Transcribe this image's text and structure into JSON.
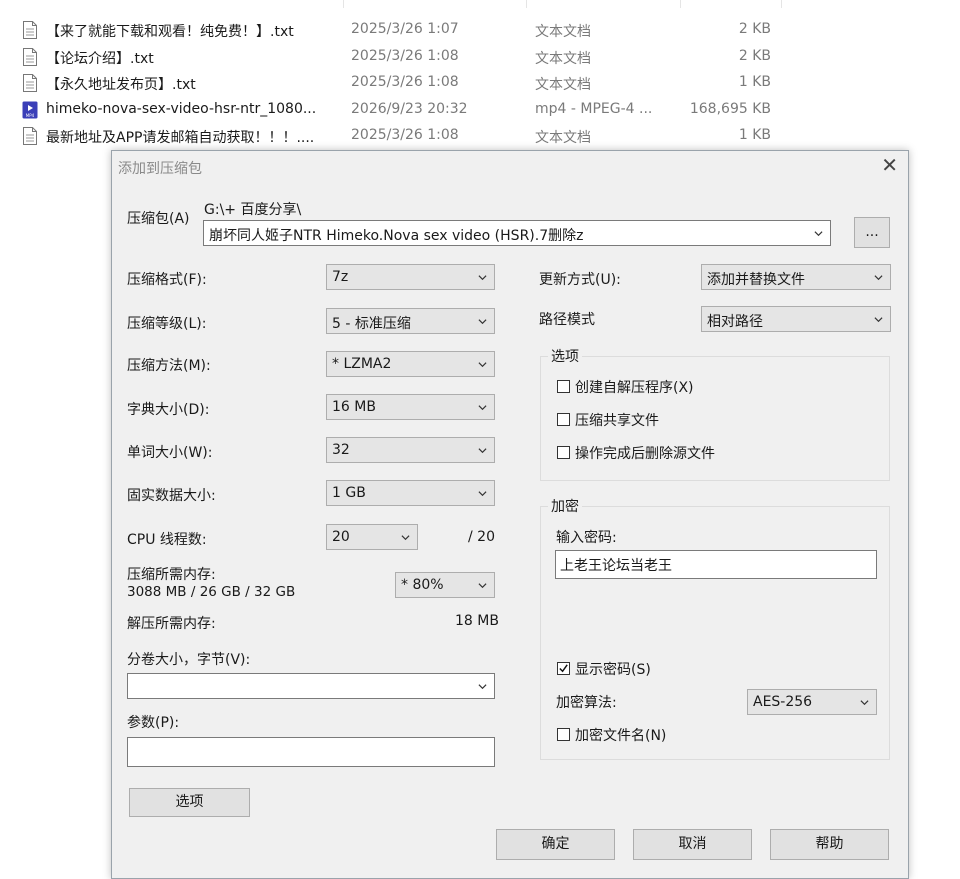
{
  "file_list": [
    {
      "name": "【来了就能下载和观看！纯免费！】.txt",
      "date": "2025/3/26 1:07",
      "type": "文本文档",
      "size": "2 KB",
      "icon": "text-file-icon"
    },
    {
      "name": "【论坛介绍】.txt",
      "date": "2025/3/26 1:08",
      "type": "文本文档",
      "size": "2 KB",
      "icon": "text-file-icon"
    },
    {
      "name": "【永久地址发布页】.txt",
      "date": "2025/3/26 1:08",
      "type": "文本文档",
      "size": "1 KB",
      "icon": "text-file-icon"
    },
    {
      "name": "himeko-nova-sex-video-hsr-ntr_1080...",
      "date": "2026/9/23 20:32",
      "type": "mp4 - MPEG-4 ...",
      "size": "168,695 KB",
      "icon": "video-file-icon"
    },
    {
      "name": "最新地址及APP请发邮箱自动获取！！！....",
      "date": "2025/3/26 1:08",
      "type": "文本文档",
      "size": "1 KB",
      "icon": "text-file-icon"
    }
  ],
  "dialog": {
    "title": "添加到压缩包",
    "archive_label": "压缩包(A)",
    "archive_path": "G:\\+ 百度分享\\",
    "archive_name": "崩坏同人姬子NTR Himeko.Nova sex video (HSR).7删除z",
    "browse_label": "...",
    "format_label": "压缩格式(F):",
    "format_value": "7z",
    "level_label": "压缩等级(L):",
    "level_value": "5 - 标准压缩",
    "method_label": "压缩方法(M):",
    "method_value": "* LZMA2",
    "dict_label": "字典大小(D):",
    "dict_value": "16 MB",
    "word_label": "单词大小(W):",
    "word_value": "32",
    "solid_label": "固实数据大小:",
    "solid_value": "1 GB",
    "cpu_label": "CPU 线程数:",
    "cpu_value": "20",
    "cpu_max": "/ 20",
    "mem_label": "压缩所需内存:",
    "mem_value": "3088 MB / 26 GB / 32 GB",
    "mem_percent": "* 80%",
    "decomp_label": "解压所需内存:",
    "decomp_value": "18 MB",
    "volume_label": "分卷大小，字节(V):",
    "volume_value": "",
    "params_label": "参数(P):",
    "params_value": "",
    "options_button": "选项",
    "update_label": "更新方式(U):",
    "update_value": "添加并替换文件",
    "path_label": "路径模式",
    "path_value": "相对路径",
    "options_group": "选项",
    "opt_sfx": "创建自解压程序(X)",
    "opt_sfx_checked": false,
    "opt_shared": "压缩共享文件",
    "opt_shared_checked": false,
    "opt_delete": "操作完成后删除源文件",
    "opt_delete_checked": false,
    "encrypt_group": "加密",
    "password_label": "输入密码:",
    "password_value": "上老王论坛当老王",
    "show_password": "显示密码(S)",
    "show_password_checked": true,
    "enc_method_label": "加密算法:",
    "enc_method_value": "AES-256",
    "encrypt_names": "加密文件名(N)",
    "encrypt_names_checked": false,
    "ok_button": "确定",
    "cancel_button": "取消",
    "help_button": "帮助"
  }
}
